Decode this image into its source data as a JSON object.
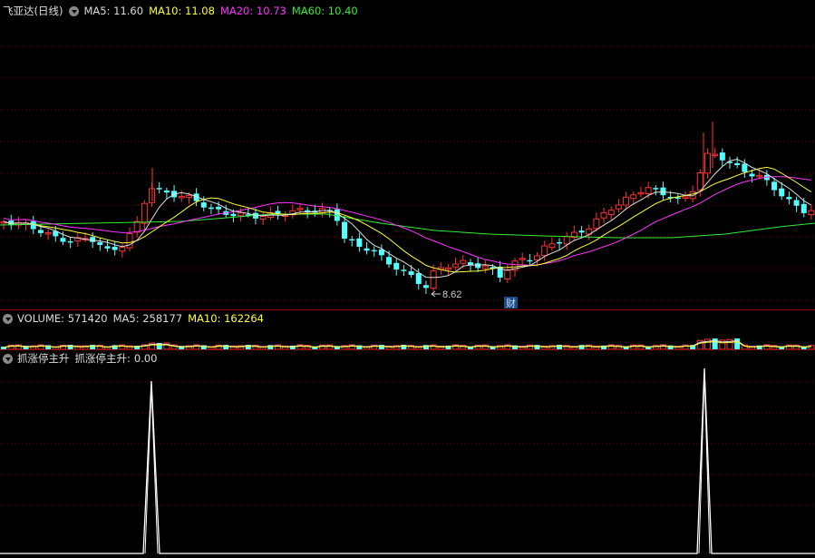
{
  "main": {
    "stock_title": "飞亚达(日线)",
    "indicators": [
      {
        "label": "MA5:",
        "value": "11.60",
        "color": "#dddddd"
      },
      {
        "label": "MA10:",
        "value": "11.08",
        "color": "#ffff33"
      },
      {
        "label": "MA20:",
        "value": "10.73",
        "color": "#ff33ff"
      },
      {
        "label": "MA60:",
        "value": "10.40",
        "color": "#33ee33"
      }
    ],
    "low_annotation": "8.62",
    "event_marker": "财"
  },
  "volume": {
    "indicators": [
      {
        "label": "VOLUME:",
        "value": "571420",
        "color": "#dddddd"
      },
      {
        "label": "MA5:",
        "value": "258177",
        "color": "#dddddd"
      },
      {
        "label": "MA10:",
        "value": "162264",
        "color": "#ffff33"
      }
    ]
  },
  "signal": {
    "title": "抓涨停主升",
    "value_label": "抓涨停主升:",
    "value": "0.00"
  },
  "colors": {
    "up": "#ff3333",
    "down": "#54ffff",
    "ma5": "#dddddd",
    "ma10": "#ffff33",
    "ma20": "#ff33ff",
    "ma60": "#33ee33",
    "grid": "#7a0000"
  }
}
